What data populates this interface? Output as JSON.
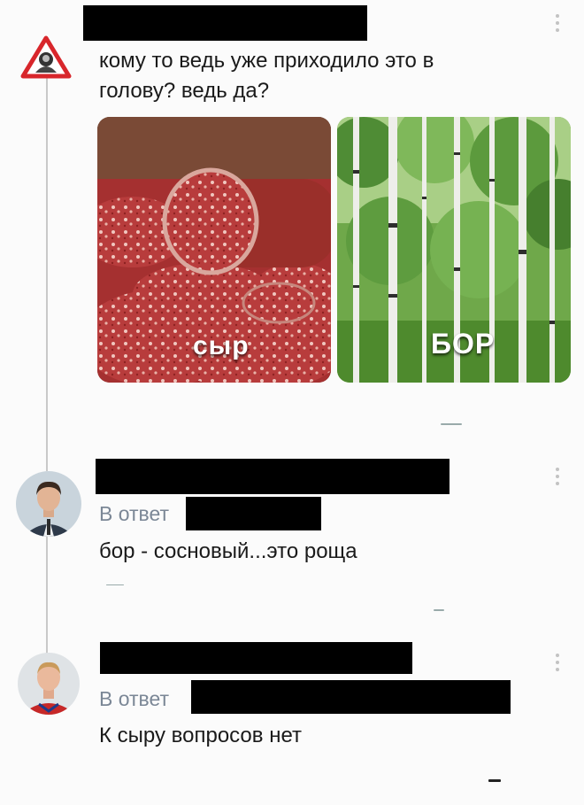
{
  "post": {
    "text_line1": "кому то ведь уже приходило это в",
    "text_line2": "голову? ведь да?",
    "images": [
      {
        "caption": "сыр",
        "icon": "salami-image"
      },
      {
        "caption": "БОР",
        "icon": "birch-forest-image"
      }
    ]
  },
  "comments": [
    {
      "reply_label": "В ответ",
      "text": "бор - сосновый...это роща"
    },
    {
      "reply_label": "В ответ",
      "text": "К сыру вопросов нет"
    }
  ],
  "colors": {
    "background": "#fbfbfb",
    "reply_label": "#7b8796",
    "thread_line": "#c9c9c9"
  }
}
